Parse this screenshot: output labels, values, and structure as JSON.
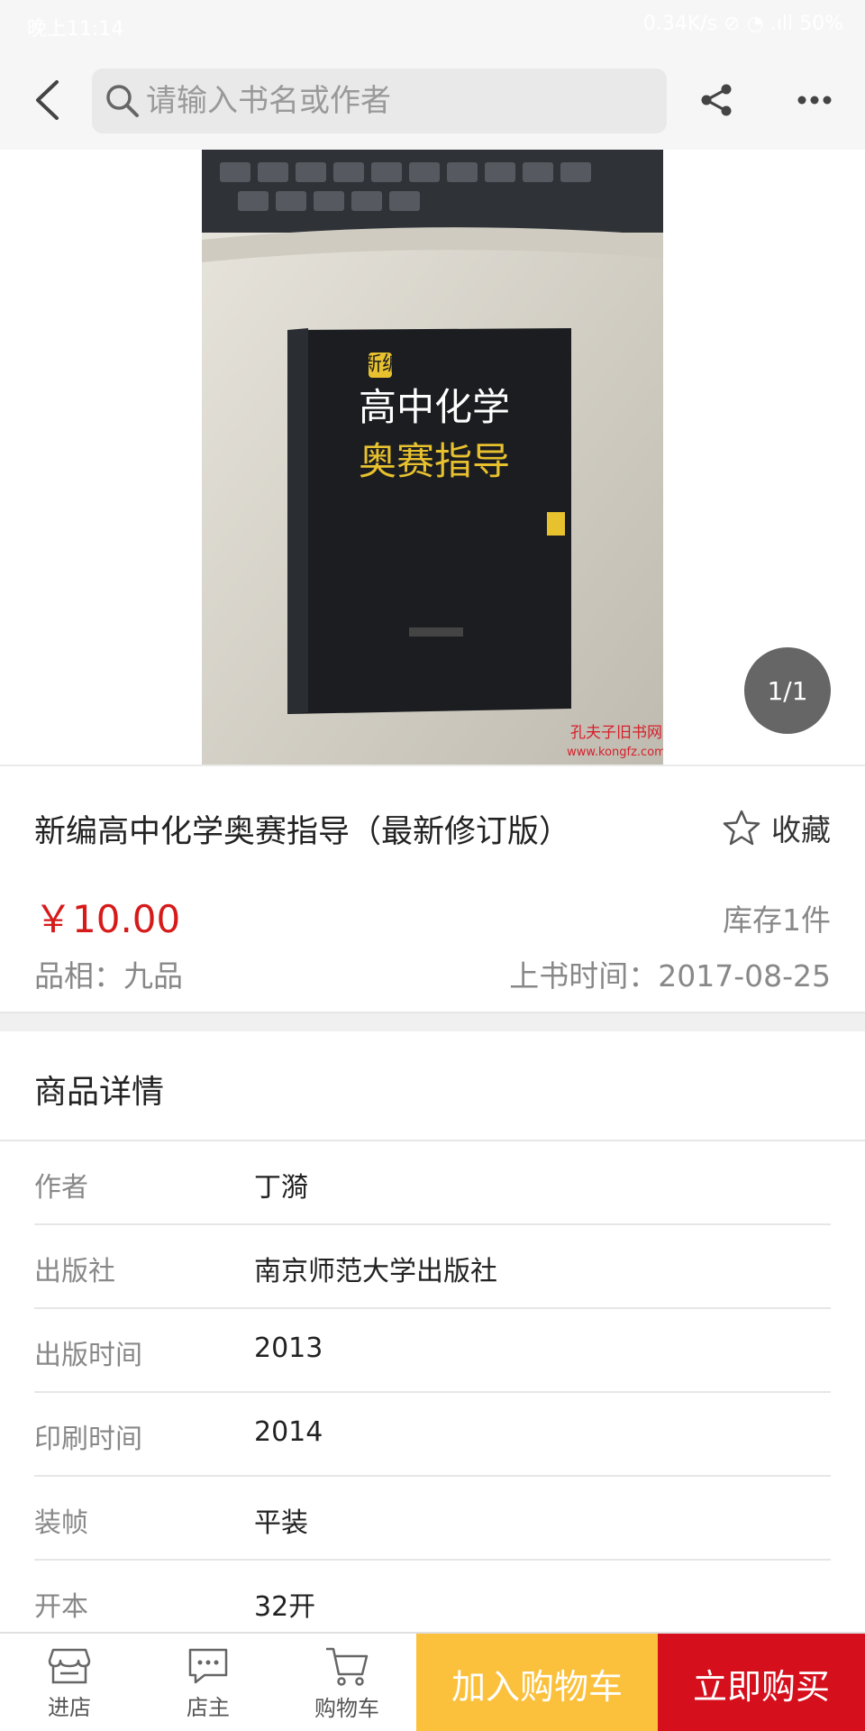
{
  "status_bar": {
    "left": "晚上11:14",
    "right": "0.34K/s  ⊘  ◔  .ıll  50%"
  },
  "search": {
    "placeholder": "请输入书名或作者"
  },
  "image": {
    "page_indicator": "1/1",
    "cover_series": "新编",
    "cover_title_1": "高中化学",
    "cover_title_2": "奥赛指导",
    "watermark_1": "孔夫子旧书网",
    "watermark_2": "www.kongfz.com"
  },
  "product": {
    "title": "新编高中化学奥赛指导（最新修订版）",
    "favorite_label": "收藏",
    "price": "￥10.00",
    "stock": "库存1件",
    "condition": "品相：九品",
    "shelf_time": "上书时间：2017-08-25"
  },
  "details": {
    "header": "商品详情",
    "rows": [
      {
        "label": "作者",
        "value": "丁漪"
      },
      {
        "label": "出版社",
        "value": "南京师范大学出版社"
      },
      {
        "label": "出版时间",
        "value": "2013"
      },
      {
        "label": "印刷时间",
        "value": "2014"
      },
      {
        "label": "装帧",
        "value": "平装"
      },
      {
        "label": "开本",
        "value": "32开"
      }
    ]
  },
  "bottom_bar": {
    "store": "进店",
    "owner": "店主",
    "cart": "购物车",
    "add_to_cart": "加入购物车",
    "buy_now": "立即购买",
    "add_to_cart_color": "#fbc13d",
    "buy_now_color": "#d60f1c"
  }
}
